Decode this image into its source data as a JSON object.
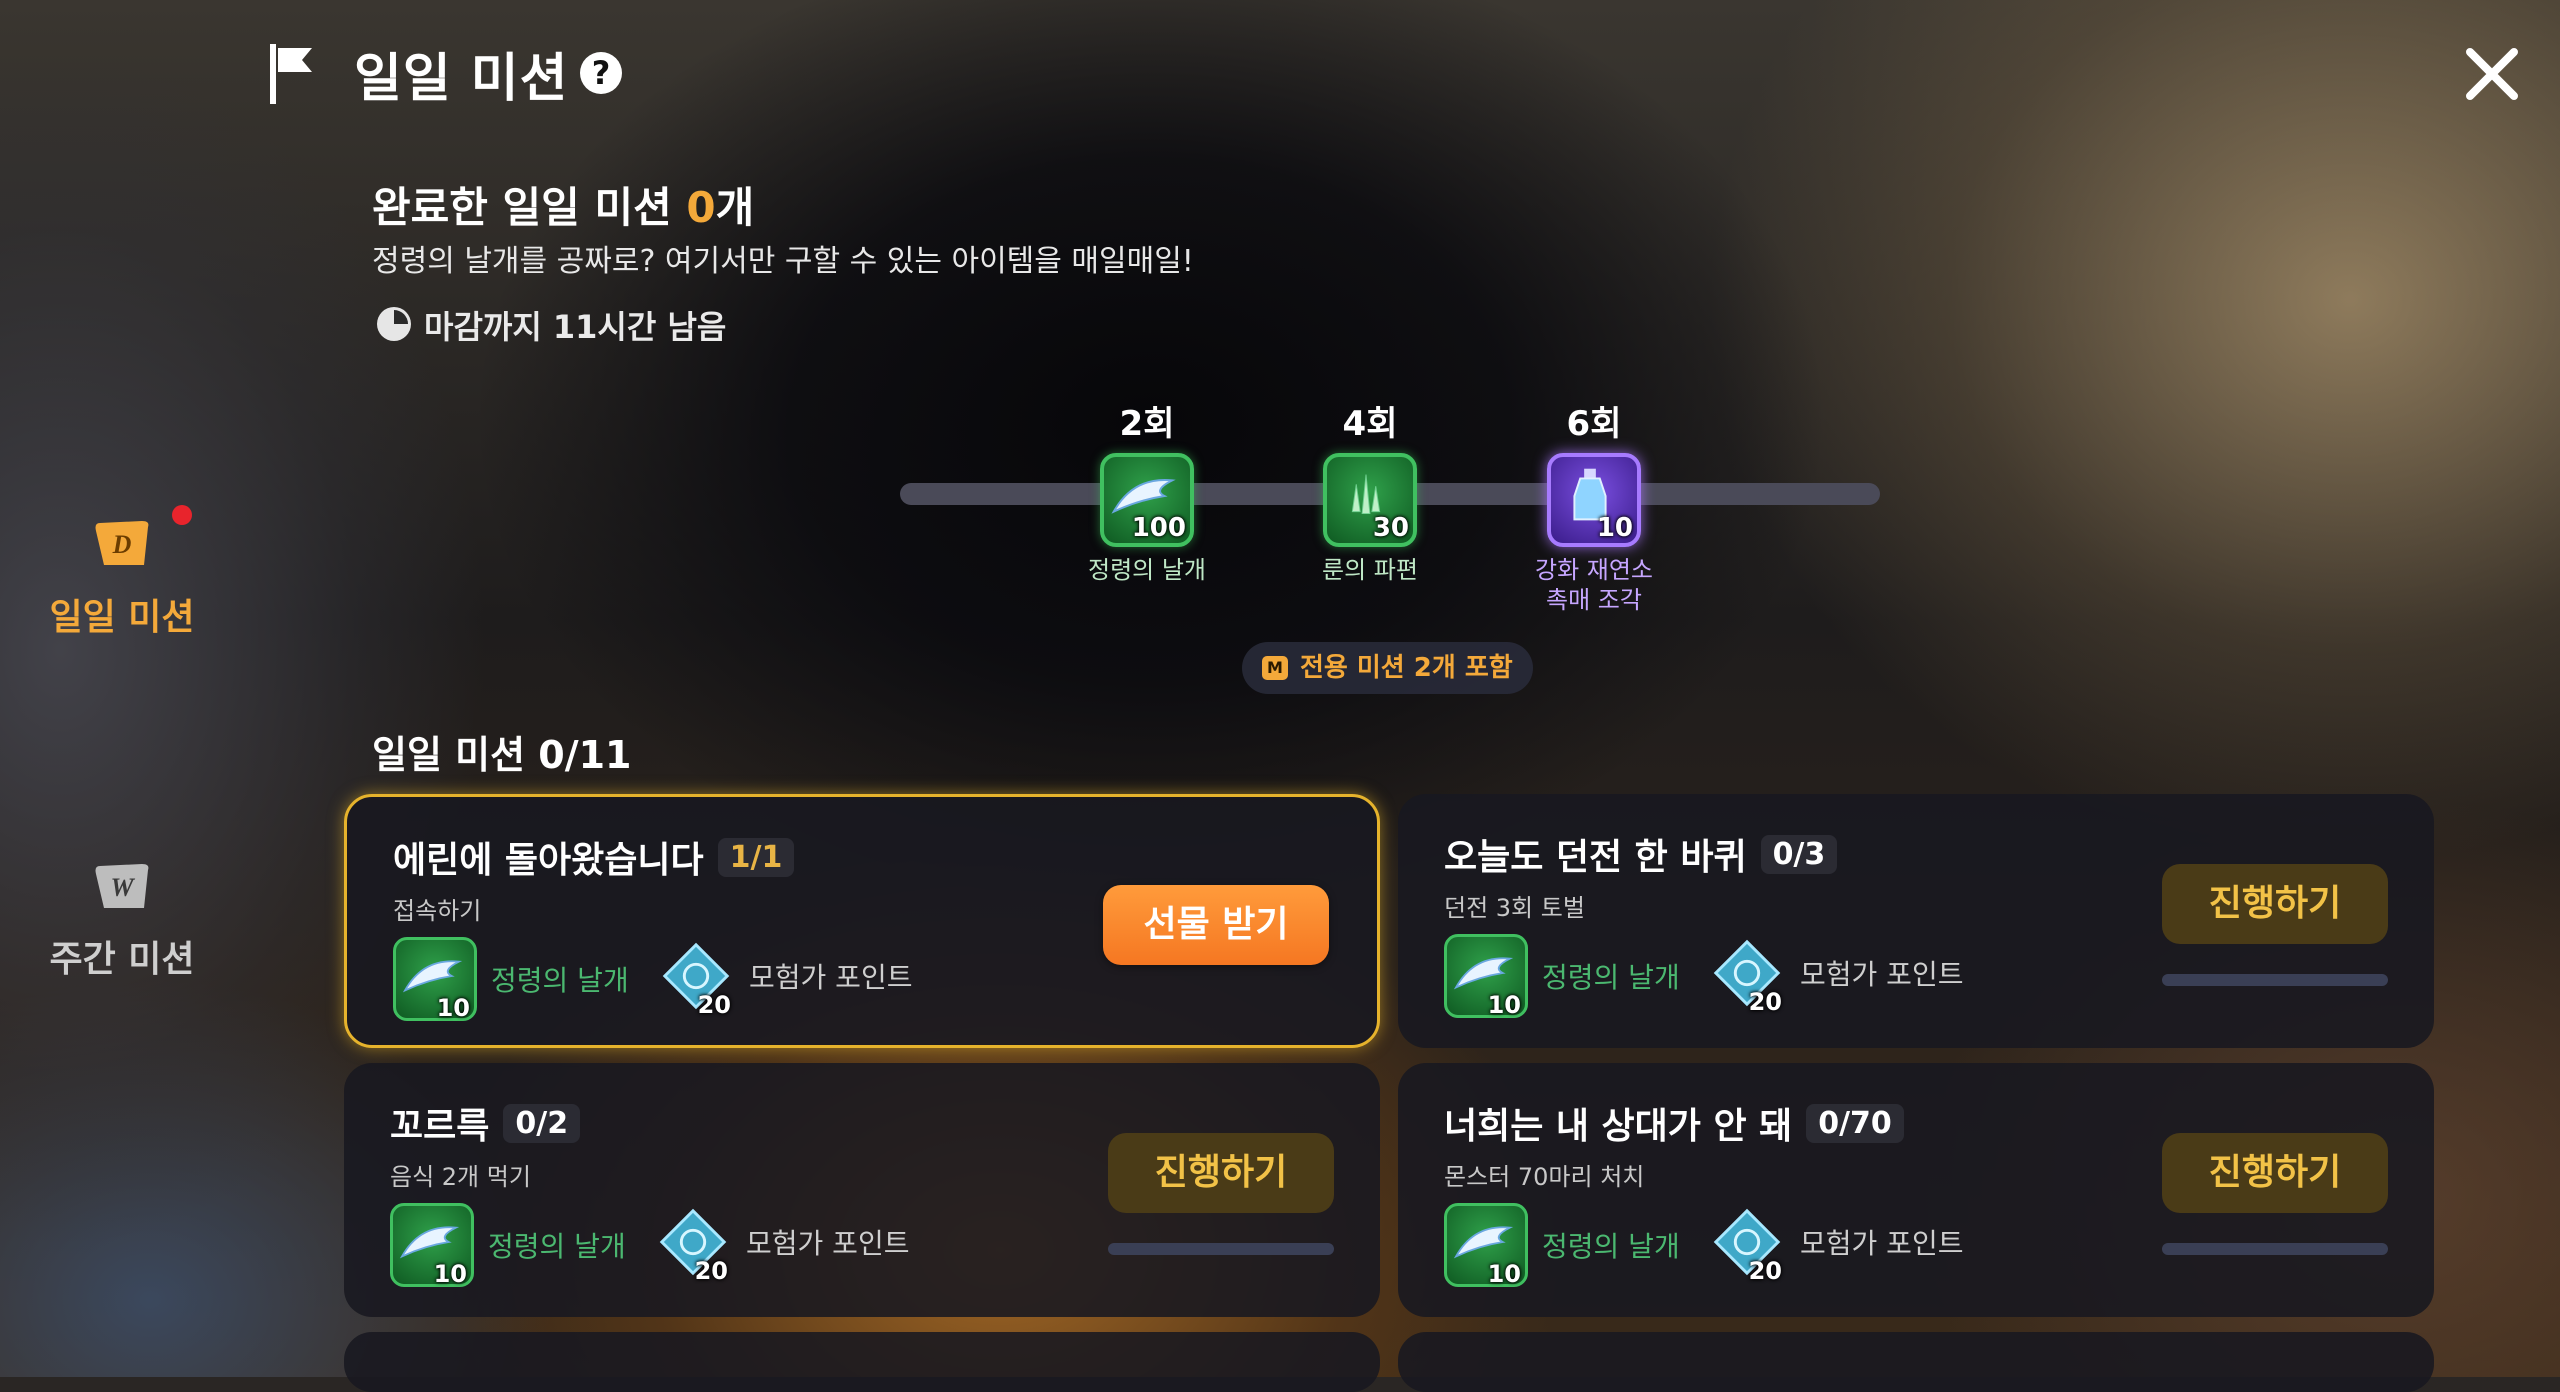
{
  "header": {
    "title": "일일 미션",
    "help": "?"
  },
  "sidebar": {
    "items": [
      {
        "label": "일일 미션",
        "icon": "daily-scroll-icon",
        "active": true,
        "badge": "red-dot"
      },
      {
        "label": "주간 미션",
        "icon": "weekly-scroll-icon",
        "active": false
      }
    ]
  },
  "summary": {
    "title_prefix": "완료한 일일 미션 ",
    "count": "0",
    "title_suffix": "개",
    "description": "정령의 날개를 공짜로? 여기서만 구할 수 있는 아이템을 매일매일!",
    "deadline": "마감까지 11시간 남음"
  },
  "milestones": [
    {
      "count": "2회",
      "qty": "100",
      "label": "정령의 날개",
      "icon": "spirit-wing-icon"
    },
    {
      "count": "4회",
      "qty": "30",
      "label": "룬의 파편",
      "icon": "rune-shard-icon"
    },
    {
      "count": "6회",
      "qty": "10",
      "label_line1": "강화 재연소",
      "label_line2": "촉매 조각",
      "icon": "catalyst-potion-icon"
    }
  ],
  "exclusive_pill": {
    "badge": "M",
    "text": "전용 미션 2개 포함"
  },
  "section_title": "일일 미션 0/11",
  "missions": [
    {
      "title": "에린에 돌아왔습니다",
      "progress": "1/1",
      "subtitle": "접속하기",
      "reward1_qty": "10",
      "reward1_label": "정령의 날개",
      "reward2_qty": "20",
      "reward2_label": "모험가 포인트",
      "button": "선물 받기"
    },
    {
      "title": "오늘도 던전 한 바퀴",
      "progress": "0/3",
      "subtitle": "던전 3회 토벌",
      "reward1_qty": "10",
      "reward1_label": "정령의 날개",
      "reward2_qty": "20",
      "reward2_label": "모험가 포인트",
      "button": "진행하기",
      "progress_fraction": 0
    },
    {
      "title": "꼬르륵",
      "progress": "0/2",
      "subtitle": "음식 2개 먹기",
      "reward1_qty": "10",
      "reward1_label": "정령의 날개",
      "reward2_qty": "20",
      "reward2_label": "모험가 포인트",
      "button": "진행하기",
      "progress_fraction": 0
    },
    {
      "title": "너희는 내 상대가 안 돼",
      "progress": "0/70",
      "subtitle": "몬스터 70마리 처치",
      "reward1_qty": "10",
      "reward1_label": "정령의 날개",
      "reward2_qty": "20",
      "reward2_label": "모험가 포인트",
      "button": "진행하기",
      "progress_fraction": 0
    }
  ],
  "colors": {
    "accent": "#f4a93a",
    "highlight_border": "#e6b32c",
    "claim_button": "#f57722",
    "progress_button": "#4a3b17"
  }
}
